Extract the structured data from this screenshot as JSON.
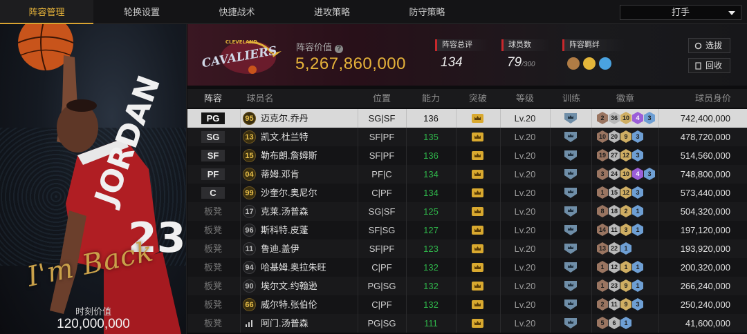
{
  "nav": {
    "tabs": [
      "阵容管理",
      "轮换设置",
      "快捷战术",
      "进攻策略",
      "防守策略"
    ],
    "active_index": 0,
    "role_select": "打手"
  },
  "player_card": {
    "signature": "I'm Back",
    "value_label": "时刻价值",
    "value": "120,000,000"
  },
  "team": {
    "logo_text": "CAVALIERS",
    "logo_subtext": "CLEVELAND",
    "lineup_value_label": "阵容价值",
    "lineup_value": "5,267,860,000",
    "overall_label": "阵容总评",
    "overall_value": "134",
    "players_label": "球员数",
    "players_value": "79",
    "players_max": "/300",
    "synergy_label": "阵容羁绊",
    "buttons": {
      "pick": "选拔",
      "recycle": "回收"
    }
  },
  "table": {
    "headers": [
      "阵容",
      "球员名",
      "位置",
      "能力",
      "突破",
      "等级",
      "训练",
      "徽章",
      "球员身价"
    ],
    "rows": [
      {
        "slot": "PG",
        "starter": true,
        "rating": "95",
        "rating_style": "gold",
        "name": "迈克尔.乔丹",
        "position": "SG|SF",
        "ability": "136",
        "level": "Lv.20",
        "badges": [
          [
            "bronze",
            "2"
          ],
          [
            "silver",
            "36"
          ],
          [
            "gold",
            "10"
          ],
          [
            "purple",
            "4"
          ],
          [
            "blue",
            "3"
          ]
        ],
        "value": "742,400,000",
        "selected": true
      },
      {
        "slot": "SG",
        "starter": true,
        "rating": "13",
        "rating_style": "gold",
        "name": "凯文.杜兰特",
        "position": "SF|PF",
        "ability": "135",
        "level": "Lv.20",
        "badges": [
          [
            "bronze",
            "10"
          ],
          [
            "silver",
            "20"
          ],
          [
            "gold",
            "9"
          ],
          [
            "blue",
            "3"
          ]
        ],
        "value": "478,720,000",
        "selected": false
      },
      {
        "slot": "SF",
        "starter": true,
        "rating": "15",
        "rating_style": "gold",
        "name": "勒布朗.詹姆斯",
        "position": "SF|PF",
        "ability": "136",
        "level": "Lv.20",
        "badges": [
          [
            "bronze",
            "19"
          ],
          [
            "silver",
            "27"
          ],
          [
            "gold",
            "12"
          ],
          [
            "blue",
            "3"
          ]
        ],
        "value": "514,560,000",
        "selected": false
      },
      {
        "slot": "PF",
        "starter": true,
        "rating": "04",
        "rating_style": "gold",
        "name": "蒂姆.邓肯",
        "position": "PF|C",
        "ability": "134",
        "level": "Lv.20",
        "badges": [
          [
            "bronze",
            "3"
          ],
          [
            "silver",
            "24"
          ],
          [
            "gold",
            "10"
          ],
          [
            "purple",
            "4"
          ],
          [
            "blue",
            "3"
          ]
        ],
        "value": "748,800,000",
        "selected": false
      },
      {
        "slot": "C",
        "starter": true,
        "rating": "99",
        "rating_style": "gold",
        "name": "沙奎尔.奥尼尔",
        "position": "C|PF",
        "ability": "134",
        "level": "Lv.20",
        "badges": [
          [
            "bronze",
            "1"
          ],
          [
            "silver",
            "15"
          ],
          [
            "gold",
            "12"
          ],
          [
            "blue",
            "3"
          ]
        ],
        "value": "573,440,000",
        "selected": false
      },
      {
        "slot": "板凳",
        "starter": false,
        "rating": "17",
        "rating_style": "dark",
        "name": "克莱.汤普森",
        "position": "SG|SF",
        "ability": "125",
        "level": "Lv.20",
        "badges": [
          [
            "bronze",
            "8"
          ],
          [
            "silver",
            "18"
          ],
          [
            "gold",
            "2"
          ],
          [
            "blue",
            "1"
          ]
        ],
        "value": "504,320,000",
        "selected": false
      },
      {
        "slot": "板凳",
        "starter": false,
        "rating": "96",
        "rating_style": "dark",
        "name": "斯科特.皮蓬",
        "position": "SF|SG",
        "ability": "127",
        "level": "Lv.20",
        "badges": [
          [
            "bronze",
            "14"
          ],
          [
            "silver",
            "11"
          ],
          [
            "gold",
            "3"
          ],
          [
            "blue",
            "1"
          ]
        ],
        "value": "197,120,000",
        "selected": false
      },
      {
        "slot": "板凳",
        "starter": false,
        "rating": "11",
        "rating_style": "dark",
        "name": "鲁迪.盖伊",
        "position": "SF|PF",
        "ability": "123",
        "level": "Lv.20",
        "badges": [
          [
            "bronze",
            "13"
          ],
          [
            "silver",
            "22"
          ],
          [
            "blue",
            "1"
          ]
        ],
        "value": "193,920,000",
        "selected": false
      },
      {
        "slot": "板凳",
        "starter": false,
        "rating": "94",
        "rating_style": "dark",
        "name": "哈基姆.奥拉朱旺",
        "position": "C|PF",
        "ability": "132",
        "level": "Lv.20",
        "badges": [
          [
            "bronze",
            "1"
          ],
          [
            "silver",
            "12"
          ],
          [
            "gold",
            "1"
          ],
          [
            "blue",
            "1"
          ]
        ],
        "value": "200,320,000",
        "selected": false
      },
      {
        "slot": "板凳",
        "starter": false,
        "rating": "90",
        "rating_style": "dark",
        "name": "埃尔文.约翰逊",
        "position": "PG|SG",
        "ability": "132",
        "level": "Lv.20",
        "badges": [
          [
            "bronze",
            "1"
          ],
          [
            "silver",
            "23"
          ],
          [
            "gold",
            "9"
          ],
          [
            "blue",
            "1"
          ]
        ],
        "value": "266,240,000",
        "selected": false
      },
      {
        "slot": "板凳",
        "starter": false,
        "rating": "66",
        "rating_style": "gold",
        "name": "威尔特.张伯伦",
        "position": "C|PF",
        "ability": "132",
        "level": "Lv.20",
        "badges": [
          [
            "bronze",
            "2"
          ],
          [
            "silver",
            "11"
          ],
          [
            "gold",
            "9"
          ],
          [
            "blue",
            "3"
          ]
        ],
        "value": "250,240,000",
        "selected": false
      },
      {
        "slot": "板凳",
        "starter": false,
        "rating": "",
        "rating_style": "bars",
        "name": "阿门.汤普森",
        "position": "PG|SG",
        "ability": "111",
        "level": "Lv.20",
        "badges": [
          [
            "bronze",
            "5"
          ],
          [
            "silver",
            "6"
          ],
          [
            "blue",
            "1"
          ]
        ],
        "value": "41,600,000",
        "selected": false
      }
    ]
  },
  "colors": {
    "accent_gold": "#e6b33a",
    "ability_green": "#2fb54a",
    "header_red": "#c8282c"
  }
}
